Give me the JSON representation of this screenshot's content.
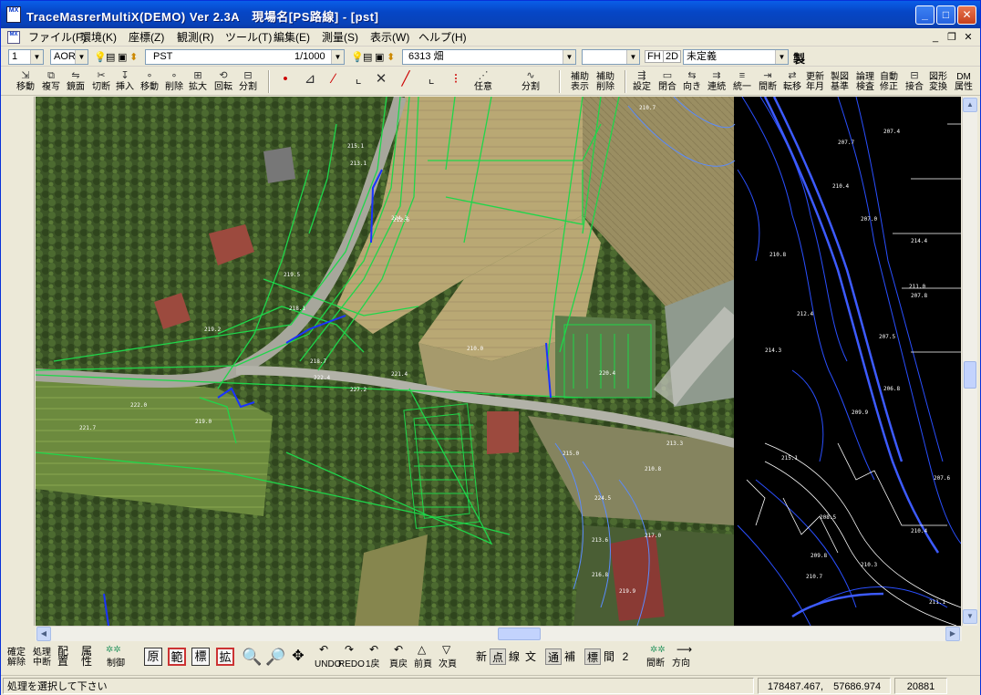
{
  "window": {
    "title": "TraceMasrerMultiX(DEMO) Ver 2.3A　現場名[PS路線] - [pst]",
    "app_icon_text": "MX"
  },
  "menu": [
    "ファイル(F)",
    "環境(K)",
    "座標(Z)",
    "観測(R)",
    "ツール(T)",
    "編集(E)",
    "測量(S)",
    "表示(W)",
    "ヘルプ(H)"
  ],
  "layerbar": {
    "view_num": "1",
    "aor": "AOR",
    "layer": "PST",
    "scale": "1/1000",
    "code": "6313 畑",
    "empty": "",
    "fh": "FH",
    "mode2d": "2D",
    "undefined": "未定義",
    "sei": "製"
  },
  "toolbar1": [
    {
      "label": "移動"
    },
    {
      "label": "複写"
    },
    {
      "label": "鏡面"
    },
    {
      "label": "切断"
    },
    {
      "label": "挿入"
    },
    {
      "label": "移動"
    },
    {
      "label": "削除"
    },
    {
      "label": "拡大"
    },
    {
      "label": "回転"
    },
    {
      "label": "分割"
    },
    {
      "label": "任意"
    },
    {
      "label": "分割"
    },
    {
      "label": "補助\n表示"
    },
    {
      "label": "補助\n削除"
    },
    {
      "label": "設定"
    },
    {
      "label": "閉合"
    },
    {
      "label": "向き"
    },
    {
      "label": "連続"
    },
    {
      "label": "統一"
    },
    {
      "label": "間断"
    },
    {
      "label": "転移"
    },
    {
      "label": "更新\n年月"
    },
    {
      "label": "製図\n基準"
    },
    {
      "label": "論理\n検査"
    },
    {
      "label": "自動\n修正"
    },
    {
      "label": "接合"
    },
    {
      "label": "図形\n変換"
    },
    {
      "label": "DM\n属性"
    }
  ],
  "toolbar2": {
    "kakutei": "確定\n解除",
    "shori": "処理\n中断",
    "haichi": "配\n置",
    "zokusei": "属\n性",
    "seigyo": "制御",
    "boxes": [
      "原",
      "範",
      "標",
      "拡"
    ],
    "undo": "UNDO",
    "redo": "REDO",
    "modoru1": "1戻",
    "pagemodoru": "頁戻",
    "prevpage": "前頁",
    "nextpage": "次頁",
    "modes1": [
      "新",
      "点",
      "線",
      "文"
    ],
    "modes2": [
      "通",
      "補"
    ],
    "modes3": [
      "標",
      "間",
      "2"
    ],
    "kandan": "間断",
    "houkou": "方向"
  },
  "status": {
    "message": "処理を選択して下さい",
    "coords": "178487.467,　57686.974",
    "number": "20881"
  },
  "map_labels": {
    "night_side": [
      "207.7",
      "207.4",
      "207.0",
      "207.8",
      "207.5",
      "207.6",
      "210.4",
      "211.0",
      "210.8",
      "215.1",
      "212.4",
      "209.8",
      "208.5",
      "211.1",
      "210.7",
      "209.9",
      "210.3",
      "210.4",
      "206.8",
      "214.3",
      "214.4"
    ],
    "photo_side": [
      "215.1",
      "212.6",
      "213.1",
      "219.5",
      "218.1",
      "210.7",
      "219.2",
      "218.7",
      "220.4",
      "222.0",
      "221.7",
      "219.0",
      "210.0",
      "210.8",
      "224.3",
      "217.0",
      "213.6",
      "216.8",
      "219.9",
      "227.2",
      "222.4",
      "215.0",
      "213.3",
      "221.4",
      "224.5"
    ]
  },
  "colors": {
    "trace_green": "#1fd64a",
    "trace_blue": "#1a33ff",
    "night_bg": "#000000",
    "titlebar": "#0a5ee8"
  }
}
